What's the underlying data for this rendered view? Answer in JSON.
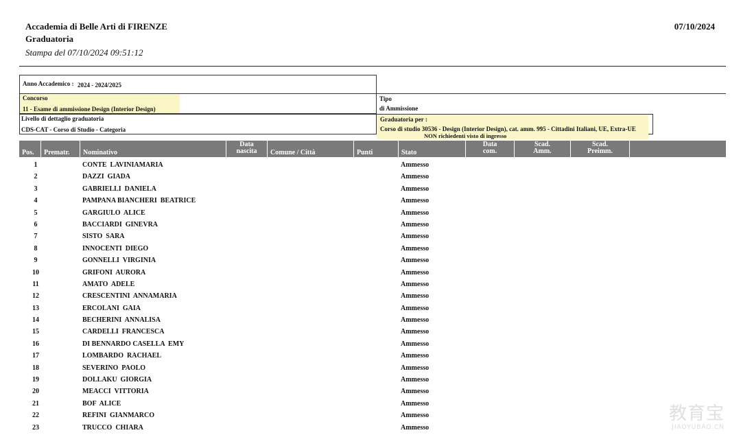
{
  "header": {
    "institution": "Accademia di Belle Arti di FIRENZE",
    "doc_type": "Graduatoria",
    "printed": "Stampa del 07/10/2024 09:51:12",
    "date": "07/10/2024"
  },
  "info": {
    "anno_label": "Anno Accademico :",
    "anno_value": "2024  -  2024/2025",
    "concorso_label": "Concorso",
    "concorso_value": "11  -  Esame di ammissione Design (Interior Design)",
    "tipo_label": "Tipo",
    "tipo_value": "di Ammissione",
    "livello_label": "Livello di dettaglio graduatoria",
    "livello_value": "CDS-CAT  -  Corso di Studio - Categoria",
    "grad_label": "Graduatoria per :",
    "grad_value": "Corso di studio  30536 - Design (Interior Design), cat. amm. 995 - Cittadini Italiani, UE, Extra-UE",
    "grad_note": "NON richiedenti visto di ingresso"
  },
  "table": {
    "headers": {
      "pos": "Pos.",
      "premat": "Prematr.",
      "nominativo": "Nominativo",
      "data_nascita_1": "Data",
      "data_nascita_2": "nascita",
      "comune": "Comune / Città",
      "punti": "Punti",
      "stato": "Stato",
      "data_com_1": "Data",
      "data_com_2": "com.",
      "scad_amm_1": "Scad.",
      "scad_amm_2": "Amm.",
      "scad_preimm_1": "Scad.",
      "scad_preimm_2": "Preimm."
    },
    "rows": [
      {
        "pos": "1",
        "name": "CONTE  LAVINIAMARIA",
        "stato": "Ammesso"
      },
      {
        "pos": "2",
        "name": "DAZZI  GIADA",
        "stato": "Ammesso"
      },
      {
        "pos": "3",
        "name": "GABRIELLI  DANIELA",
        "stato": "Ammesso"
      },
      {
        "pos": "4",
        "name": "PAMPANA BIANCHERI  BEATRICE",
        "stato": "Ammesso"
      },
      {
        "pos": "5",
        "name": "GARGIULO  ALICE",
        "stato": "Ammesso"
      },
      {
        "pos": "6",
        "name": "BACCIARDI  GINEVRA",
        "stato": "Ammesso"
      },
      {
        "pos": "7",
        "name": "SISTO  SARA",
        "stato": "Ammesso"
      },
      {
        "pos": "8",
        "name": "INNOCENTI  DIEGO",
        "stato": "Ammesso"
      },
      {
        "pos": "9",
        "name": "GONNELLI  VIRGINIA",
        "stato": "Ammesso"
      },
      {
        "pos": "10",
        "name": "GRIFONI  AURORA",
        "stato": "Ammesso"
      },
      {
        "pos": "11",
        "name": "AMATO  ADELE",
        "stato": "Ammesso"
      },
      {
        "pos": "12",
        "name": "CRESCENTINI  ANNAMARIA",
        "stato": "Ammesso"
      },
      {
        "pos": "13",
        "name": "ERCOLANI  GAIA",
        "stato": "Ammesso"
      },
      {
        "pos": "14",
        "name": "BECHERINI  ANNALISA",
        "stato": "Ammesso"
      },
      {
        "pos": "15",
        "name": "CARDELLI  FRANCESCA",
        "stato": "Ammesso"
      },
      {
        "pos": "16",
        "name": "DI BENNARDO CASELLA  EMY",
        "stato": "Ammesso"
      },
      {
        "pos": "17",
        "name": "LOMBARDO  RACHAEL",
        "stato": "Ammesso"
      },
      {
        "pos": "18",
        "name": "SEVERINO  PAOLO",
        "stato": "Ammesso"
      },
      {
        "pos": "19",
        "name": "DOLLAKU  GIORGIA",
        "stato": "Ammesso"
      },
      {
        "pos": "20",
        "name": "MEACCI  VITTORIA",
        "stato": "Ammesso"
      },
      {
        "pos": "21",
        "name": "BOF  ALICE",
        "stato": "Ammesso"
      },
      {
        "pos": "22",
        "name": "REFINI  GIANMARCO",
        "stato": "Ammesso"
      },
      {
        "pos": "23",
        "name": "TRUCCO  CHIARA",
        "stato": "Ammesso"
      }
    ]
  },
  "watermark": {
    "big": "教育宝",
    "small": "JIAOYUBAO.CN"
  },
  "colors": {
    "header_bg": "#7a7a7a",
    "highlight": "#fbf6c8"
  }
}
